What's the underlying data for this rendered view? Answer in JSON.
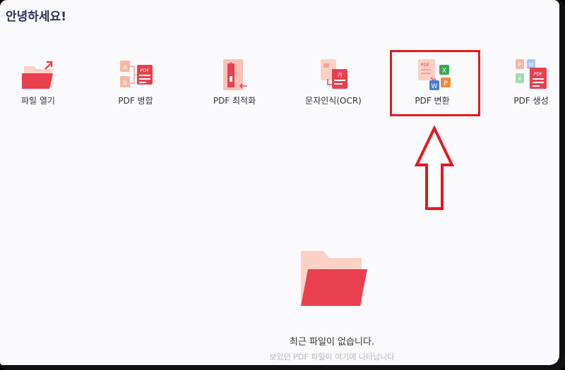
{
  "greeting": "안녕하세요!",
  "tools": [
    {
      "label": "파일 열기",
      "icon": "folder-open-icon"
    },
    {
      "label": "PDF 병합",
      "icon": "merge-pdf-icon"
    },
    {
      "label": "PDF 최적화",
      "icon": "compress-pdf-icon"
    },
    {
      "label": "문자인식(OCR)",
      "icon": "ocr-icon"
    },
    {
      "label": "PDF 변환",
      "icon": "convert-pdf-icon"
    },
    {
      "label": "PDF 생성",
      "icon": "create-pdf-icon"
    }
  ],
  "empty_state": {
    "title": "최근 파일이 없습니다.",
    "subtitle": "보았던 PDF 파일이 여기에 나타납니다"
  },
  "colors": {
    "accent": "#e8404f",
    "accent_light": "#f8c0b8",
    "highlight": "#e8171f",
    "green": "#3aa853",
    "blue": "#4a7fd4",
    "orange": "#ee8a3a"
  }
}
